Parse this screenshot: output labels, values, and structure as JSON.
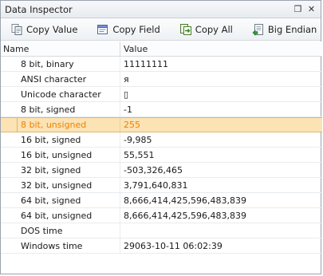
{
  "window": {
    "title": "Data Inspector",
    "controls": {
      "restore": "❐",
      "close": "✕"
    }
  },
  "toolbar": {
    "copy_value_label": "Copy Value",
    "copy_field_label": "Copy Field",
    "copy_all_label": "Copy All",
    "big_endian_label": "Big Endian"
  },
  "grid": {
    "columns": {
      "name": "Name",
      "value": "Value"
    },
    "rows": [
      {
        "name": "8 bit, binary",
        "value": "11111111"
      },
      {
        "name": "ANSI character",
        "value": "я"
      },
      {
        "name": "Unicode character",
        "value": "▯"
      },
      {
        "name": "8 bit, signed",
        "value": "-1"
      },
      {
        "name": "8 bit, unsigned",
        "value": "255"
      },
      {
        "name": "16 bit, signed",
        "value": "-9,985"
      },
      {
        "name": "16 bit, unsigned",
        "value": "55,551"
      },
      {
        "name": "32 bit, signed",
        "value": "-503,326,465"
      },
      {
        "name": "32 bit, unsigned",
        "value": "3,791,640,831"
      },
      {
        "name": "64 bit, signed",
        "value": "8,666,414,425,596,483,839"
      },
      {
        "name": "64 bit, unsigned",
        "value": "8,666,414,425,596,483,839"
      },
      {
        "name": "DOS time",
        "value": ""
      },
      {
        "name": "Windows time",
        "value": "29063-10-11 06:02:39"
      }
    ]
  },
  "colors": {
    "selected_row_bg": "#fbe3b4",
    "selected_row_text": "#f08000",
    "selected_row_border": "#e5b46a"
  }
}
